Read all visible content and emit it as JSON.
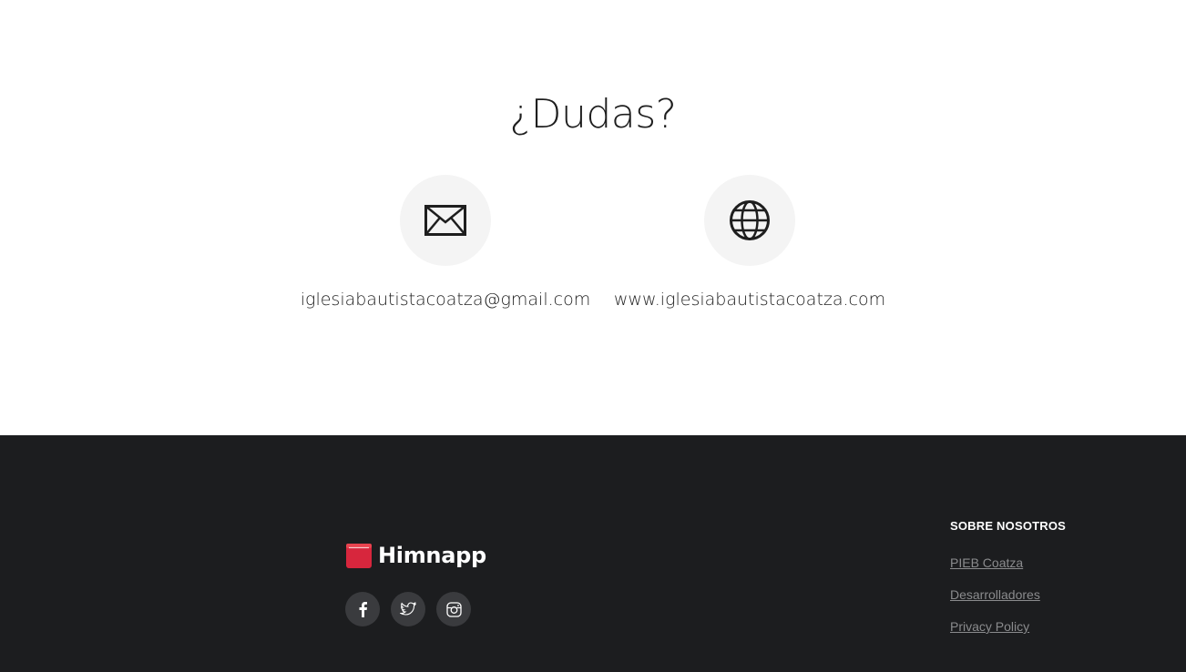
{
  "contact": {
    "title": "¿Dudas?",
    "email": {
      "icon": "envelope-icon",
      "text": "iglesiabautistacoatza@gmail.com"
    },
    "website": {
      "icon": "globe-icon",
      "text": "www.iglesiabautistacoatza.com"
    }
  },
  "footer": {
    "logo": {
      "icon": "book-icon",
      "text": "Himnapp",
      "icon_color": "#d7263d"
    },
    "social": [
      {
        "icon": "facebook-icon"
      },
      {
        "icon": "twitter-icon"
      },
      {
        "icon": "instagram-icon"
      }
    ],
    "about": {
      "title": "SOBRE NOSOTROS",
      "links": [
        "PIEB Coatza",
        "Desarrolladores",
        "Privacy Policy"
      ]
    }
  },
  "colors": {
    "footer_bg": "#1c1d1f",
    "icon_circle_bg": "#f4f4f4",
    "brand_red": "#d7263d"
  }
}
